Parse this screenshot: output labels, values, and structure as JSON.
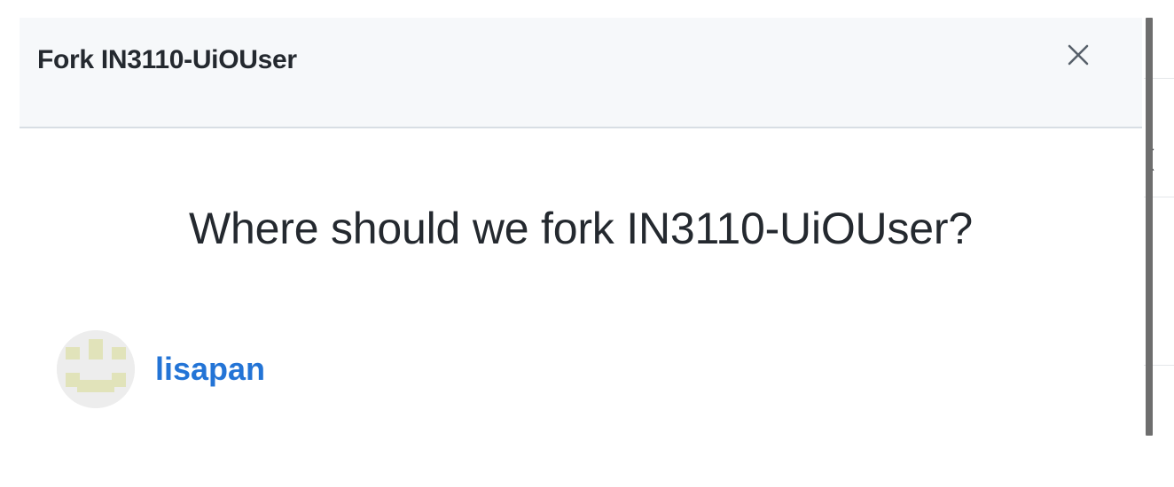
{
  "dialog": {
    "title": "Fork IN3110-UiOUser",
    "question": "Where should we fork IN3110-UiOUser?",
    "close_icon": "close-icon"
  },
  "owners": [
    {
      "name": "lisapan",
      "avatar": "identicon-avatar",
      "avatar_color": "#e1e3ba"
    }
  ],
  "colors": {
    "header_bg": "#f6f8fa",
    "link": "#2374d6",
    "text": "#24292f"
  }
}
